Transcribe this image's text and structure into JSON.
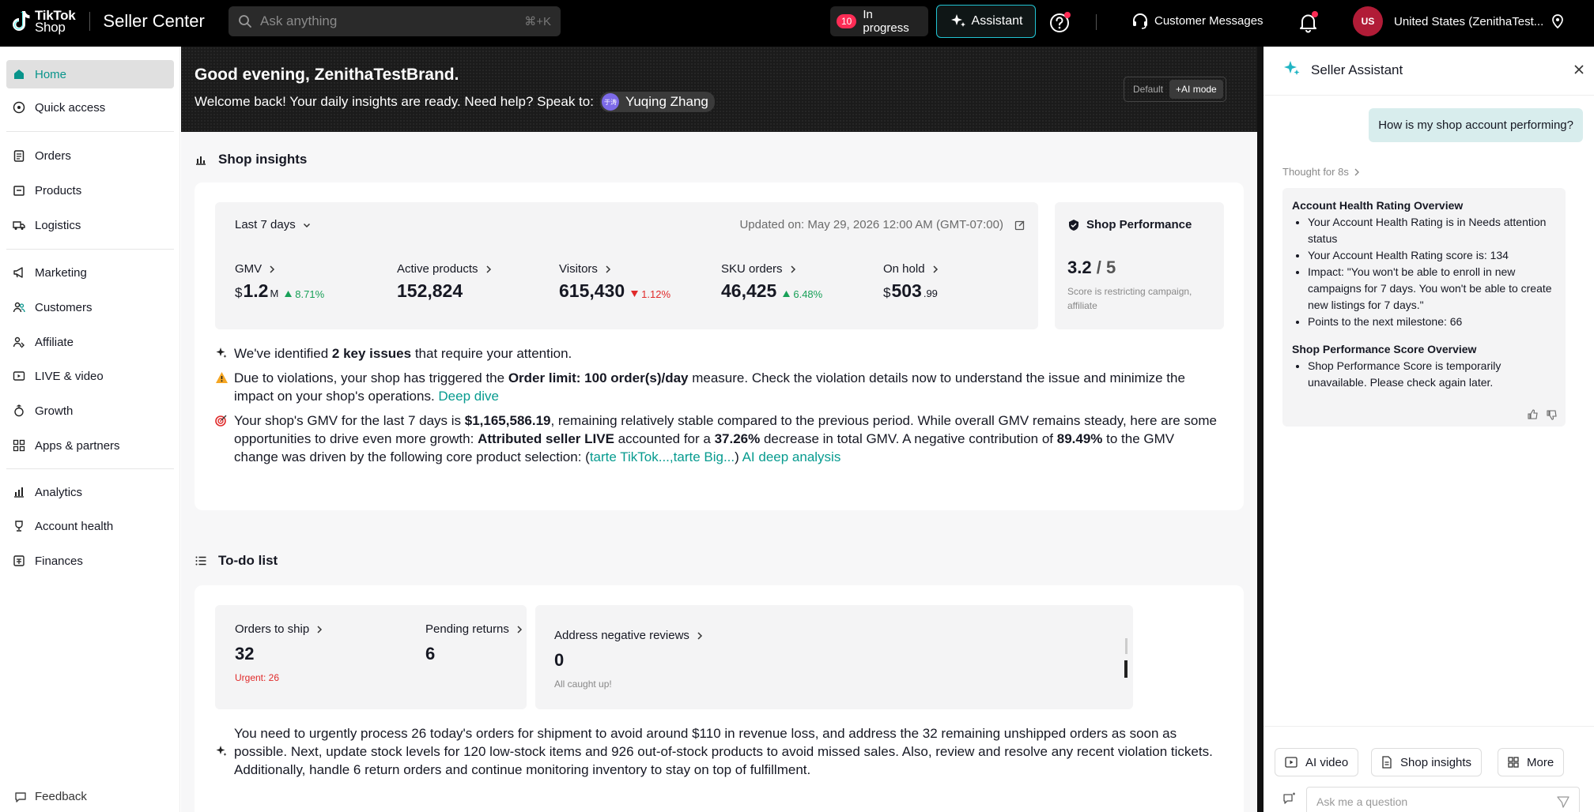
{
  "topbar": {
    "logo_line1": "TikTok",
    "logo_line2": "Shop",
    "app_name": "Seller Center",
    "search_placeholder": "Ask anything",
    "search_shortcut": "⌘+K",
    "in_progress_count": "10",
    "in_progress_label": "In progress",
    "assistant_label": "Assistant",
    "customer_messages_label": "Customer Messages",
    "avatar_initials": "US",
    "account_label": "United States  (ZenithaTest..."
  },
  "sidebar": {
    "items": [
      {
        "label": "Home",
        "icon": "home-icon"
      },
      {
        "label": "Quick access",
        "icon": "compass-icon"
      },
      {
        "label": "Orders",
        "icon": "clipboard-icon"
      },
      {
        "label": "Products",
        "icon": "box-icon"
      },
      {
        "label": "Logistics",
        "icon": "truck-icon"
      },
      {
        "label": "Marketing",
        "icon": "megaphone-icon"
      },
      {
        "label": "Customers",
        "icon": "users-icon"
      },
      {
        "label": "Affiliate",
        "icon": "affiliate-icon"
      },
      {
        "label": "LIVE & video",
        "icon": "video-icon"
      },
      {
        "label": "Growth",
        "icon": "growth-icon"
      },
      {
        "label": "Apps & partners",
        "icon": "apps-icon"
      },
      {
        "label": "Analytics",
        "icon": "analytics-icon"
      },
      {
        "label": "Account health",
        "icon": "trophy-icon"
      },
      {
        "label": "Finances",
        "icon": "finance-icon"
      }
    ],
    "feedback_label": "Feedback"
  },
  "banner": {
    "greeting": "Good evening, ZenithaTestBrand.",
    "welcome": "Welcome back! Your daily insights are ready. Need help? Speak to:",
    "agent_initials": "于涛",
    "agent_name": "Yuqing Zhang",
    "mode_default": "Default",
    "mode_ai": "+AI mode"
  },
  "insights": {
    "section_title": "Shop insights",
    "period": "Last 7 days",
    "updated": "Updated on: May 29, 2026 12:00 AM (GMT-07:00)",
    "metrics": [
      {
        "label": "GMV",
        "prefix": "$",
        "value": "1.2",
        "suffix": "M",
        "change": "8.71%",
        "direction": "up"
      },
      {
        "label": "Active products",
        "prefix": "",
        "value": "152,824",
        "suffix": "",
        "change": "",
        "direction": ""
      },
      {
        "label": "Visitors",
        "prefix": "",
        "value": "615,430",
        "suffix": "",
        "change": "1.12%",
        "direction": "down"
      },
      {
        "label": "SKU orders",
        "prefix": "",
        "value": "46,425",
        "suffix": "",
        "change": "6.48%",
        "direction": "up"
      },
      {
        "label": "On hold",
        "prefix": "$",
        "value": "503",
        "suffix": ".99",
        "change": "",
        "direction": ""
      }
    ],
    "performance": {
      "title": "Shop Performance",
      "score": "3.2",
      "max": "/ 5",
      "note": "Score is restricting campaign, affiliate"
    },
    "summary_pre": "We've identified ",
    "summary_bold": "2 key issues",
    "summary_post": " that require your attention.",
    "issue1_pre": "Due to violations, your shop has triggered the ",
    "issue1_bold": "Order limit: 100 order(s)/day",
    "issue1_post": " measure. Check the violation details now to understand the issue and minimize the impact on your shop's operations. ",
    "issue1_link": "Deep dive",
    "issue2_a": "Your shop's GMV for the last 7 days is ",
    "issue2_b": "$1,165,586.19",
    "issue2_c": ", remaining relatively stable compared to the previous period. While overall GMV remains steady, here are some opportunities to drive even more growth: ",
    "issue2_d": "Attributed seller LIVE",
    "issue2_e": " accounted for a ",
    "issue2_f": "37.26%",
    "issue2_g": " decrease in total GMV. A negative contribution of ",
    "issue2_h": "89.49%",
    "issue2_i": " to the GMV change was driven by the following core product selection: (",
    "issue2_link1": "tarte TikTok...",
    "issue2_comma": ",",
    "issue2_link2": "tarte Big...",
    "issue2_j": ") ",
    "issue2_link3": "AI deep analysis"
  },
  "todo": {
    "section_title": "To-do list",
    "orders_to_ship_label": "Orders to ship",
    "orders_to_ship_value": "32",
    "orders_to_ship_sub": "Urgent: 26",
    "pending_returns_label": "Pending returns",
    "pending_returns_value": "6",
    "reviews_label": "Address negative reviews",
    "reviews_value": "0",
    "reviews_sub": "All caught up!",
    "summary": "You need to urgently process 26 today's orders for shipment to avoid around $110 in revenue loss, and address the 32 remaining unshipped orders as soon as possible. Next, update stock levels for 120 low-stock items and 926 out-of-stock products to avoid missed sales. Also, review and resolve any recent violation tickets. Additionally, handle 6 return orders and continue monitoring inventory to stay on top of fulfillment."
  },
  "assistant": {
    "title": "Seller Assistant",
    "user_message": "How is my shop account performing?",
    "thought": "Thought for 8s",
    "section1_title": "Account Health Rating Overview",
    "section1_items": [
      "Your Account Health Rating is in Needs attention status",
      "Your Account Health Rating score is: 134",
      "Impact: \"You won't be able to enroll in new campaigns for 7 days. You won't be able to create new listings for 7 days.\"",
      "Points to the next milestone: 66"
    ],
    "section2_title": "Shop Performance Score Overview",
    "section2_items": [
      "Shop Performance Score is temporarily unavailable. Please check again later."
    ],
    "chips": [
      "AI video",
      "Shop insights",
      "More"
    ],
    "ask_placeholder": "Ask me a question"
  },
  "colors": {
    "accent": "#21c4d3",
    "link": "#079b8f",
    "up": "#18a058",
    "down": "#e02a2a",
    "badge": "#fe2c55"
  }
}
